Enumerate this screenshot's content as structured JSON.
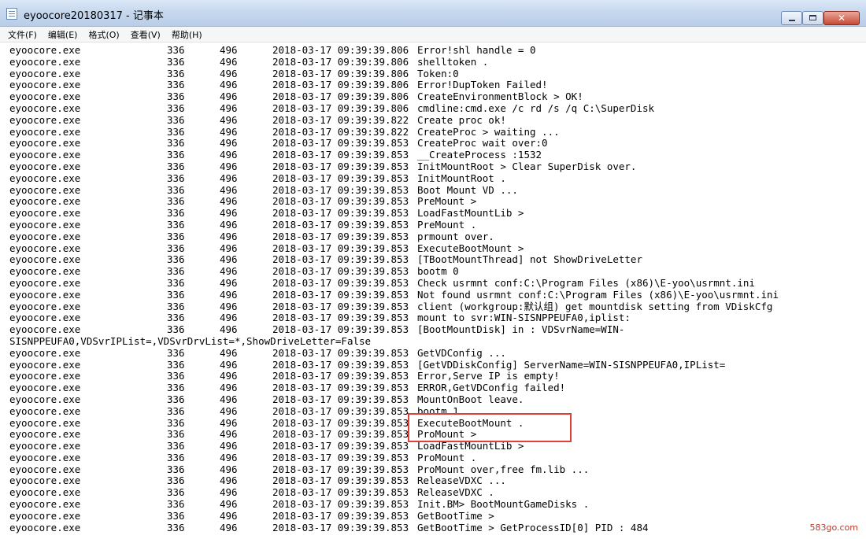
{
  "window": {
    "title": "eyoocore20180317 - 记事本",
    "buttons": {
      "minimize": "minimize",
      "maximize": "maximize",
      "close": "close"
    }
  },
  "menu": [
    {
      "label": "文件(F)"
    },
    {
      "label": "编辑(E)"
    },
    {
      "label": "格式(O)"
    },
    {
      "label": "查看(V)"
    },
    {
      "label": "帮助(H)"
    }
  ],
  "log": [
    {
      "proc": "eyoocore.exe",
      "a": "336",
      "b": "496",
      "ts": "2018-03-17 09:39:39.806",
      "msg": "Error!shl handle = 0"
    },
    {
      "proc": "eyoocore.exe",
      "a": "336",
      "b": "496",
      "ts": "2018-03-17 09:39:39.806",
      "msg": "shelltoken ."
    },
    {
      "proc": "eyoocore.exe",
      "a": "336",
      "b": "496",
      "ts": "2018-03-17 09:39:39.806",
      "msg": "Token:0"
    },
    {
      "proc": "eyoocore.exe",
      "a": "336",
      "b": "496",
      "ts": "2018-03-17 09:39:39.806",
      "msg": "Error!DupToken Failed!"
    },
    {
      "proc": "eyoocore.exe",
      "a": "336",
      "b": "496",
      "ts": "2018-03-17 09:39:39.806",
      "msg": "CreateEnvironmentBlock > OK!"
    },
    {
      "proc": "eyoocore.exe",
      "a": "336",
      "b": "496",
      "ts": "2018-03-17 09:39:39.806",
      "msg": "cmdline:cmd.exe /c rd /s /q C:\\SuperDisk"
    },
    {
      "proc": "eyoocore.exe",
      "a": "336",
      "b": "496",
      "ts": "2018-03-17 09:39:39.822",
      "msg": "Create proc ok!"
    },
    {
      "proc": "eyoocore.exe",
      "a": "336",
      "b": "496",
      "ts": "2018-03-17 09:39:39.822",
      "msg": "CreateProc > waiting ..."
    },
    {
      "proc": "eyoocore.exe",
      "a": "336",
      "b": "496",
      "ts": "2018-03-17 09:39:39.853",
      "msg": "CreateProc wait over:0"
    },
    {
      "proc": "eyoocore.exe",
      "a": "336",
      "b": "496",
      "ts": "2018-03-17 09:39:39.853",
      "msg": "__CreateProcess :1532"
    },
    {
      "proc": "eyoocore.exe",
      "a": "336",
      "b": "496",
      "ts": "2018-03-17 09:39:39.853",
      "msg": "InitMountRoot > Clear SuperDisk over."
    },
    {
      "proc": "eyoocore.exe",
      "a": "336",
      "b": "496",
      "ts": "2018-03-17 09:39:39.853",
      "msg": "InitMountRoot ."
    },
    {
      "proc": "eyoocore.exe",
      "a": "336",
      "b": "496",
      "ts": "2018-03-17 09:39:39.853",
      "msg": "Boot Mount VD ..."
    },
    {
      "proc": "eyoocore.exe",
      "a": "336",
      "b": "496",
      "ts": "2018-03-17 09:39:39.853",
      "msg": "PreMount >"
    },
    {
      "proc": "eyoocore.exe",
      "a": "336",
      "b": "496",
      "ts": "2018-03-17 09:39:39.853",
      "msg": "LoadFastMountLib >"
    },
    {
      "proc": "eyoocore.exe",
      "a": "336",
      "b": "496",
      "ts": "2018-03-17 09:39:39.853",
      "msg": "PreMount ."
    },
    {
      "proc": "eyoocore.exe",
      "a": "336",
      "b": "496",
      "ts": "2018-03-17 09:39:39.853",
      "msg": "prmount over."
    },
    {
      "proc": "eyoocore.exe",
      "a": "336",
      "b": "496",
      "ts": "2018-03-17 09:39:39.853",
      "msg": "ExecuteBootMount >"
    },
    {
      "proc": "eyoocore.exe",
      "a": "336",
      "b": "496",
      "ts": "2018-03-17 09:39:39.853",
      "msg": "[TBootMountThread] not ShowDriveLetter"
    },
    {
      "proc": "eyoocore.exe",
      "a": "336",
      "b": "496",
      "ts": "2018-03-17 09:39:39.853",
      "msg": "bootm 0"
    },
    {
      "proc": "eyoocore.exe",
      "a": "336",
      "b": "496",
      "ts": "2018-03-17 09:39:39.853",
      "msg": "Check usrmnt conf:C:\\Program Files (x86)\\E-yoo\\usrmnt.ini"
    },
    {
      "proc": "eyoocore.exe",
      "a": "336",
      "b": "496",
      "ts": "2018-03-17 09:39:39.853",
      "msg": "Not found usrmnt conf:C:\\Program Files (x86)\\E-yoo\\usrmnt.ini"
    },
    {
      "proc": "eyoocore.exe",
      "a": "336",
      "b": "496",
      "ts": "2018-03-17 09:39:39.853",
      "msg": "client (workgroup:默认组) get mountdisk setting from VDiskCfg"
    },
    {
      "proc": "eyoocore.exe",
      "a": "336",
      "b": "496",
      "ts": "2018-03-17 09:39:39.853",
      "msg": "mount to svr:WIN-SISNPPEUFA0,iplist:"
    },
    {
      "proc": "eyoocore.exe",
      "a": "336",
      "b": "496",
      "ts": "2018-03-17 09:39:39.853",
      "msg": "[BootMountDisk] in : VDSvrName=WIN-"
    },
    {
      "wrap": "SISNPPEUFA0,VDSvrIPList=,VDSvrDrvList=*,ShowDriveLetter=False"
    },
    {
      "proc": "eyoocore.exe",
      "a": "336",
      "b": "496",
      "ts": "2018-03-17 09:39:39.853",
      "msg": "GetVDConfig ..."
    },
    {
      "proc": "eyoocore.exe",
      "a": "336",
      "b": "496",
      "ts": "2018-03-17 09:39:39.853",
      "msg": "[GetVDDiskConfig] ServerName=WIN-SISNPPEUFA0,IPList="
    },
    {
      "proc": "eyoocore.exe",
      "a": "336",
      "b": "496",
      "ts": "2018-03-17 09:39:39.853",
      "msg": "Error,Serve IP is empty!"
    },
    {
      "proc": "eyoocore.exe",
      "a": "336",
      "b": "496",
      "ts": "2018-03-17 09:39:39.853",
      "msg": "ERROR,GetVDConfig failed!"
    },
    {
      "proc": "eyoocore.exe",
      "a": "336",
      "b": "496",
      "ts": "2018-03-17 09:39:39.853",
      "msg": "MountOnBoot leave."
    },
    {
      "proc": "eyoocore.exe",
      "a": "336",
      "b": "496",
      "ts": "2018-03-17 09:39:39.853",
      "msg": "bootm 1"
    },
    {
      "proc": "eyoocore.exe",
      "a": "336",
      "b": "496",
      "ts": "2018-03-17 09:39:39.853",
      "msg": "ExecuteBootMount ."
    },
    {
      "proc": "eyoocore.exe",
      "a": "336",
      "b": "496",
      "ts": "2018-03-17 09:39:39.853",
      "msg": "ProMount >"
    },
    {
      "proc": "eyoocore.exe",
      "a": "336",
      "b": "496",
      "ts": "2018-03-17 09:39:39.853",
      "msg": "LoadFastMountLib >"
    },
    {
      "proc": "eyoocore.exe",
      "a": "336",
      "b": "496",
      "ts": "2018-03-17 09:39:39.853",
      "msg": "ProMount ."
    },
    {
      "proc": "eyoocore.exe",
      "a": "336",
      "b": "496",
      "ts": "2018-03-17 09:39:39.853",
      "msg": "ProMount over,free fm.lib ..."
    },
    {
      "proc": "eyoocore.exe",
      "a": "336",
      "b": "496",
      "ts": "2018-03-17 09:39:39.853",
      "msg": "ReleaseVDXC ..."
    },
    {
      "proc": "eyoocore.exe",
      "a": "336",
      "b": "496",
      "ts": "2018-03-17 09:39:39.853",
      "msg": "ReleaseVDXC ."
    },
    {
      "proc": "eyoocore.exe",
      "a": "336",
      "b": "496",
      "ts": "2018-03-17 09:39:39.853",
      "msg": "Init.BM> BootMountGameDisks ."
    },
    {
      "proc": "eyoocore.exe",
      "a": "336",
      "b": "496",
      "ts": "2018-03-17 09:39:39.853",
      "msg": "GetBootTime >"
    },
    {
      "proc": "eyoocore.exe",
      "a": "336",
      "b": "496",
      "ts": "2018-03-17 09:39:39.853",
      "msg": "GetBootTime > GetProcessID[0] PID : 484"
    }
  ],
  "watermark": "583go.com",
  "colors": {
    "highlight": "#e0403a",
    "watermark": "#c0392b"
  }
}
